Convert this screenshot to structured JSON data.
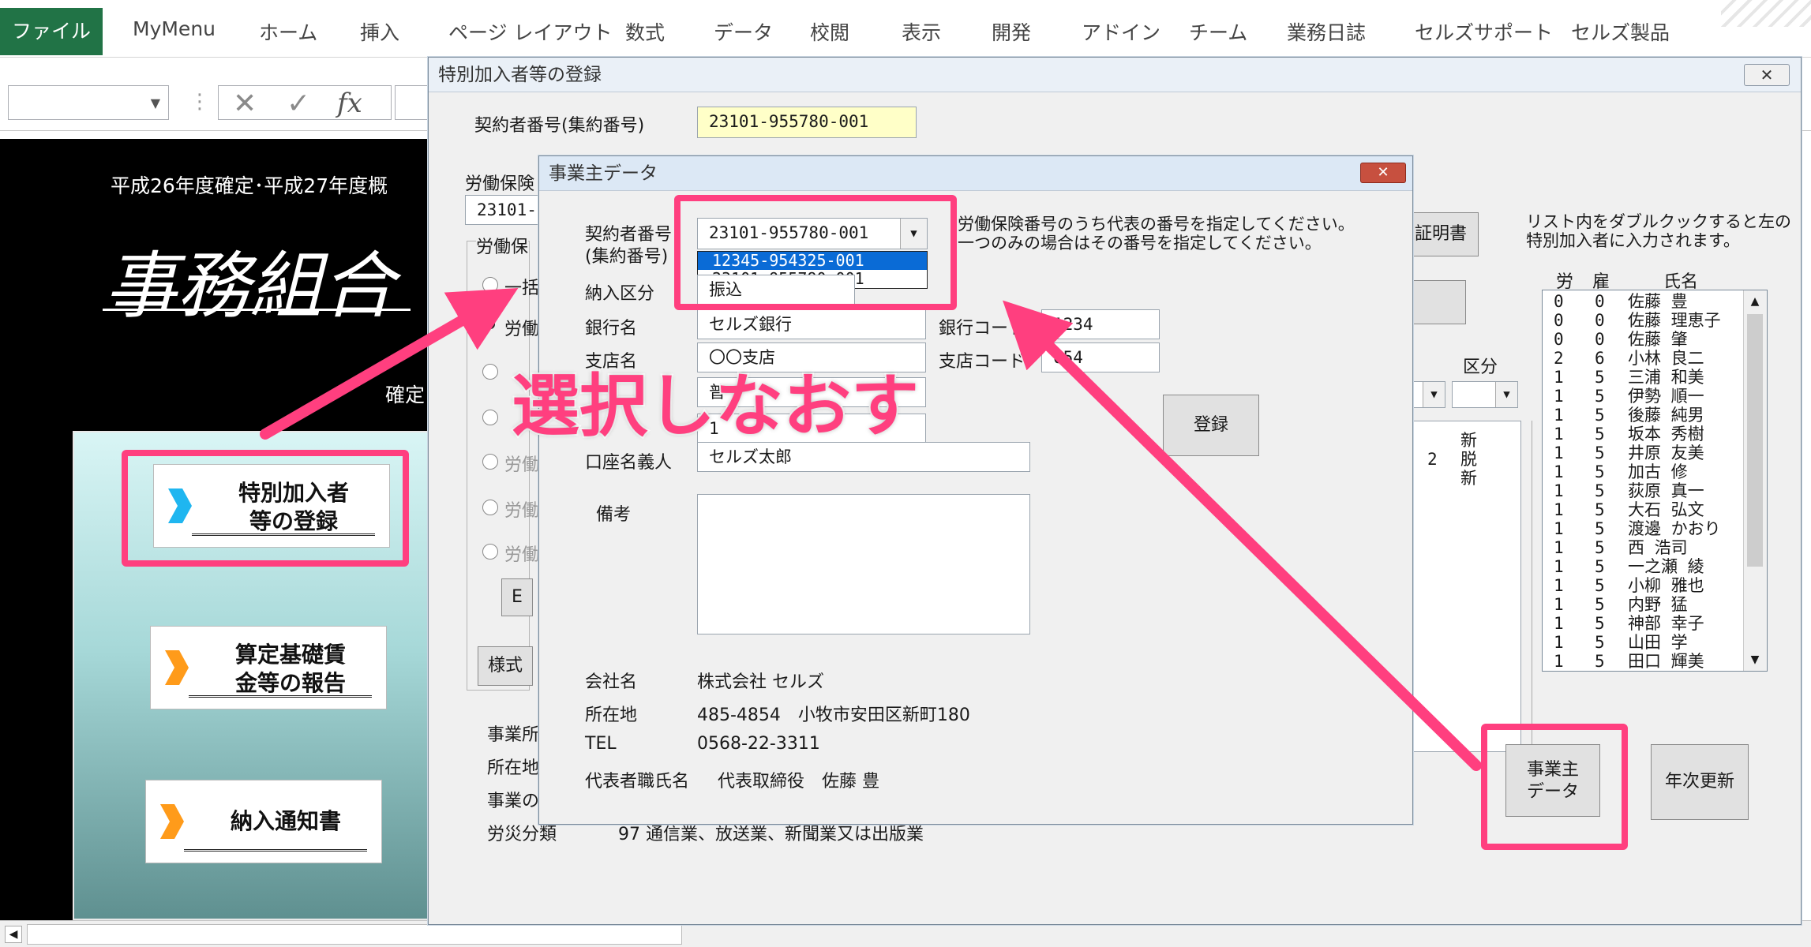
{
  "ribbon": {
    "tabs": [
      "ファイル",
      "MyMenu",
      "ホーム",
      "挿入",
      "ページ レイアウト",
      "数式",
      "データ",
      "校閲",
      "表示",
      "開発",
      "アドイン",
      "チーム",
      "業務日誌",
      "セルズサポート",
      "セルズ製品"
    ]
  },
  "formula_bar": {
    "cancel": "✕",
    "enter": "✓",
    "fx": "fx"
  },
  "sheet": {
    "header_text": "平成26年度確定･平成27年度概",
    "title": "事務組合",
    "sub_text": "確定",
    "menu_buttons": [
      {
        "label": "特別加入者\n等の登録"
      },
      {
        "label": "算定基礎賃\n金等の報告"
      },
      {
        "label": "納入通知書"
      }
    ]
  },
  "main_dialog": {
    "title": "特別加入者等の登録",
    "close": "✕",
    "contract_label": "契約者番号(集約番号)",
    "contract_value": "23101-955780-001",
    "rousai_label": "労働保険",
    "rousai_value": "23101-",
    "group_label": "労働保",
    "radios": [
      "一括",
      "労働",
      "",
      "",
      "労働",
      "労働",
      "労働"
    ],
    "style_button": "様式",
    "small_button": "E",
    "info_labels": [
      "事業所",
      "所在地",
      "事業の",
      "労災分類"
    ],
    "rousai_class_value": "97 通信業、放送業、新聞業又は出版業",
    "certificate_button": "人証明書",
    "hint_text": "リスト内をダブルクックすると左の\n特別加入者に入力されます。",
    "kubun_label": "区分",
    "mid_list": [
      {
        "n": "",
        "k": "新"
      },
      {
        "n": "2",
        "k": "脱"
      },
      {
        "n": "",
        "k": "新"
      }
    ],
    "list_headers": [
      "労",
      "雇",
      "氏名"
    ],
    "list": [
      {
        "r": "0",
        "k": "0",
        "name": "佐藤 豊"
      },
      {
        "r": "0",
        "k": "0",
        "name": "佐藤 理恵子"
      },
      {
        "r": "0",
        "k": "0",
        "name": "佐藤 肇"
      },
      {
        "r": "2",
        "k": "6",
        "name": "小林 良二"
      },
      {
        "r": "1",
        "k": "5",
        "name": "三浦 和美"
      },
      {
        "r": "1",
        "k": "5",
        "name": "伊勢 順一"
      },
      {
        "r": "1",
        "k": "5",
        "name": "後藤 純男"
      },
      {
        "r": "1",
        "k": "5",
        "name": "坂本 秀樹"
      },
      {
        "r": "1",
        "k": "5",
        "name": "井原 友美"
      },
      {
        "r": "1",
        "k": "5",
        "name": "加古 修"
      },
      {
        "r": "1",
        "k": "5",
        "name": "荻原 真一"
      },
      {
        "r": "1",
        "k": "5",
        "name": "大石 弘文"
      },
      {
        "r": "1",
        "k": "5",
        "name": "渡邊 かおり"
      },
      {
        "r": "1",
        "k": "5",
        "name": "西 浩司"
      },
      {
        "r": "1",
        "k": "5",
        "name": "一之瀬 綾"
      },
      {
        "r": "1",
        "k": "5",
        "name": "小柳 雅也"
      },
      {
        "r": "1",
        "k": "5",
        "name": "内野 猛"
      },
      {
        "r": "1",
        "k": "5",
        "name": "神部 幸子"
      },
      {
        "r": "1",
        "k": "5",
        "name": "山田 学"
      },
      {
        "r": "1",
        "k": "5",
        "name": "田口 輝美"
      }
    ],
    "employer_button": "事業主\nデータ",
    "annual_button": "年次更新"
  },
  "employer_dialog": {
    "title": "事業主データ",
    "close": "✕",
    "contract_label": "契約者番号\n(集約番号)",
    "contract_value": "23101-955780-001",
    "dropdown_options": [
      "12345-954325-001",
      "23101-955780-001"
    ],
    "hint": "労働保険番号のうち代表の番号を指定してください。\n一つのみの場合はその番号を指定してください。",
    "payment_label": "納入区分",
    "payment_value": "振込",
    "bank_label": "銀行名",
    "bank_value": "セルズ銀行",
    "bank_code_label": "銀行コード",
    "bank_code_value": "1234",
    "branch_label": "支店名",
    "branch_value": "〇〇支店",
    "branch_code_label": "支店コード",
    "branch_code_value": "654",
    "account_type_prefix": "普",
    "account_num_prefix": "1",
    "register_button": "登録",
    "holder_label": "口座名義人",
    "holder_value": "セルズ太郎",
    "notes_label": "備考",
    "company_label": "会社名",
    "company_value": "株式会社 セルズ",
    "address_label": "所在地",
    "address_value": "485-4854　小牧市安田区新町180",
    "tel_label": "TEL",
    "tel_value": "0568-22-3311",
    "rep_label": "代表者職氏名",
    "rep_value": "代表取締役　佐藤 豊"
  },
  "annotation": {
    "callout": "選択しなおす",
    "color": "#ff3f7f"
  }
}
